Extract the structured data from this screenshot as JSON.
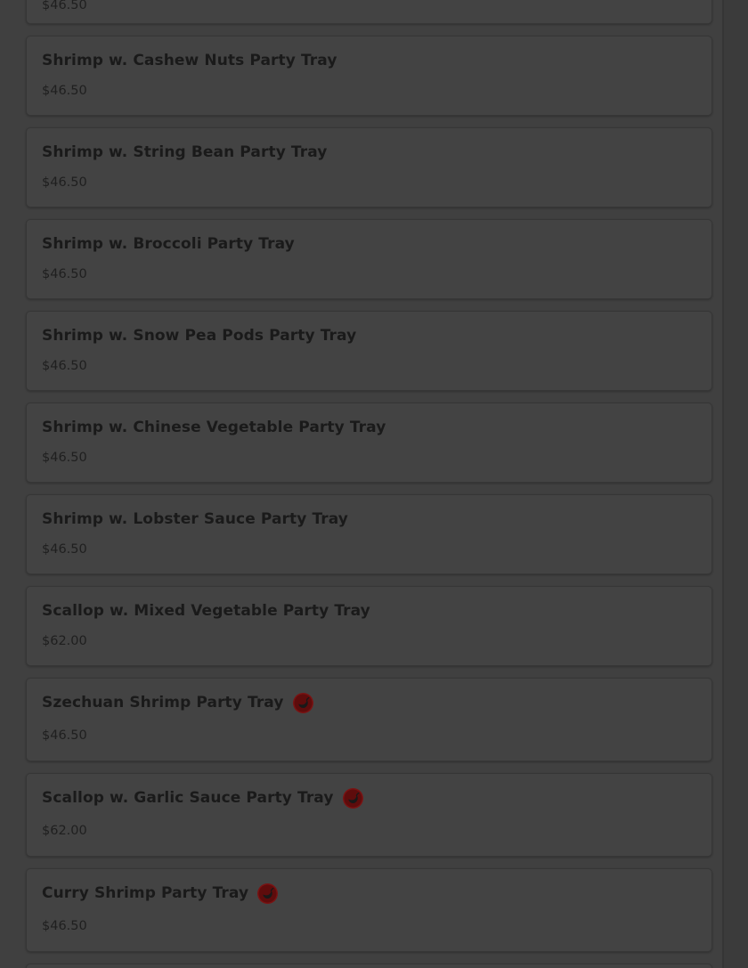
{
  "items": [
    {
      "name": "",
      "price": "$46.50",
      "spicy": false
    },
    {
      "name": "Shrimp w. Cashew Nuts Party Tray",
      "price": "$46.50",
      "spicy": false
    },
    {
      "name": "Shrimp w. String Bean Party Tray",
      "price": "$46.50",
      "spicy": false
    },
    {
      "name": "Shrimp w. Broccoli Party Tray",
      "price": "$46.50",
      "spicy": false
    },
    {
      "name": "Shrimp w. Snow Pea Pods Party Tray",
      "price": "$46.50",
      "spicy": false
    },
    {
      "name": "Shrimp w. Chinese Vegetable Party Tray",
      "price": "$46.50",
      "spicy": false
    },
    {
      "name": "Shrimp w. Lobster Sauce Party Tray",
      "price": "$46.50",
      "spicy": false
    },
    {
      "name": "Scallop w. Mixed Vegetable Party Tray",
      "price": "$62.00",
      "spicy": false
    },
    {
      "name": "Szechuan Shrimp Party Tray",
      "price": "$46.50",
      "spicy": true
    },
    {
      "name": "Scallop w. Garlic Sauce Party Tray",
      "price": "$62.00",
      "spicy": true
    },
    {
      "name": "Curry Shrimp Party Tray",
      "price": "$46.50",
      "spicy": true
    }
  ],
  "icons": {
    "spicy": "chili-pepper-icon"
  },
  "colors": {
    "overlay_background": "#404040",
    "card_background": "#434343",
    "spicy_red": "#7a1212"
  }
}
